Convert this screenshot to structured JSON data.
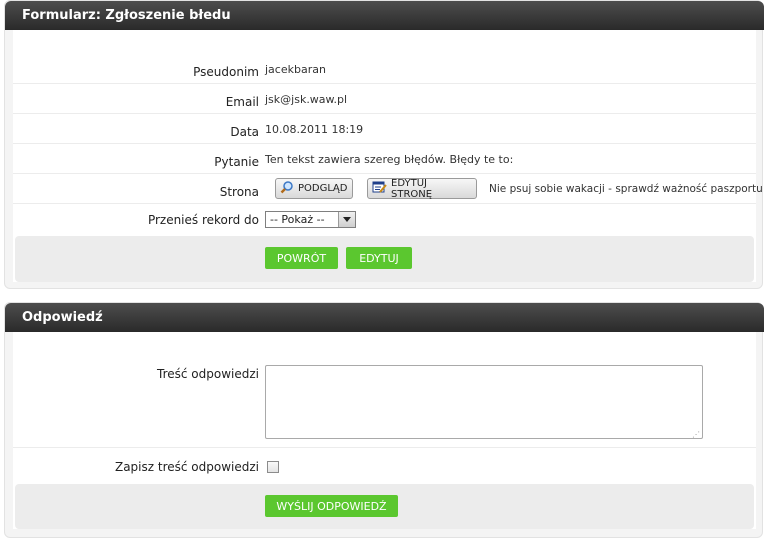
{
  "report_form": {
    "title": "Formularz: Zgłoszenie błedu",
    "fields": {
      "pseudonim_label": "Pseudonim",
      "pseudonim_value": "jacekbaran",
      "email_label": "Email",
      "email_value": "jsk@jsk.waw.pl",
      "data_label": "Data",
      "data_value": "10.08.2011 18:19",
      "pytanie_label": "Pytanie",
      "pytanie_value": "Ten tekst zawiera szereg błędów. Błędy te to:",
      "strona_label": "Strona",
      "strona_page_title": "Nie psuj sobie wakacji - sprawdź ważność paszportu",
      "move_label": "Przenieś rekord do",
      "move_selected": "-- Pokaż --"
    },
    "buttons": {
      "preview": "PODGLĄD",
      "edit_page": "EDYTUJ STRONĘ",
      "back": "POWRÓT",
      "edit": "EDYTUJ"
    }
  },
  "reply_form": {
    "title": "Odpowiedź",
    "content_label": "Treść odpowiedzi",
    "save_label": "Zapisz treść odpowiedzi",
    "save_checked": false,
    "send_button": "WYŚLIJ ODPOWIEDŹ"
  },
  "colors": {
    "header_bg": "#333333",
    "primary_button": "#5bc72f"
  },
  "icons": {
    "preview": "magnifier-icon",
    "edit_page": "edit-page-icon"
  }
}
